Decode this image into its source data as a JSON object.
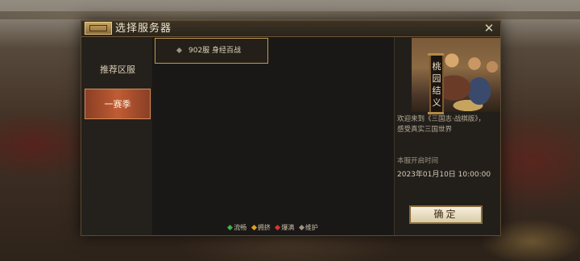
{
  "dialog": {
    "title": "选择服务器",
    "close_symbol": "✕"
  },
  "nav": {
    "items": [
      {
        "label": "推荐区服",
        "selected": false
      },
      {
        "label": "一赛季",
        "selected": true
      }
    ]
  },
  "servers": [
    {
      "label": "902服 身经百战",
      "status": "maintenance"
    }
  ],
  "legend": [
    {
      "label": "流畅",
      "color": "#3fb34a"
    },
    {
      "label": "拥挤",
      "color": "#e0a020"
    },
    {
      "label": "爆满",
      "color": "#d8362c"
    },
    {
      "label": "维护",
      "color": "#9c9484"
    }
  ],
  "info": {
    "banner_title": "桃园结义",
    "welcome_line1": "欢迎来到《三国志·战棋版》，",
    "welcome_line2": "感受真实三国世界",
    "open_time_label": "本服开启时间",
    "open_time_value": "2023年01月10日  10:00:00",
    "confirm_label": "确定"
  }
}
